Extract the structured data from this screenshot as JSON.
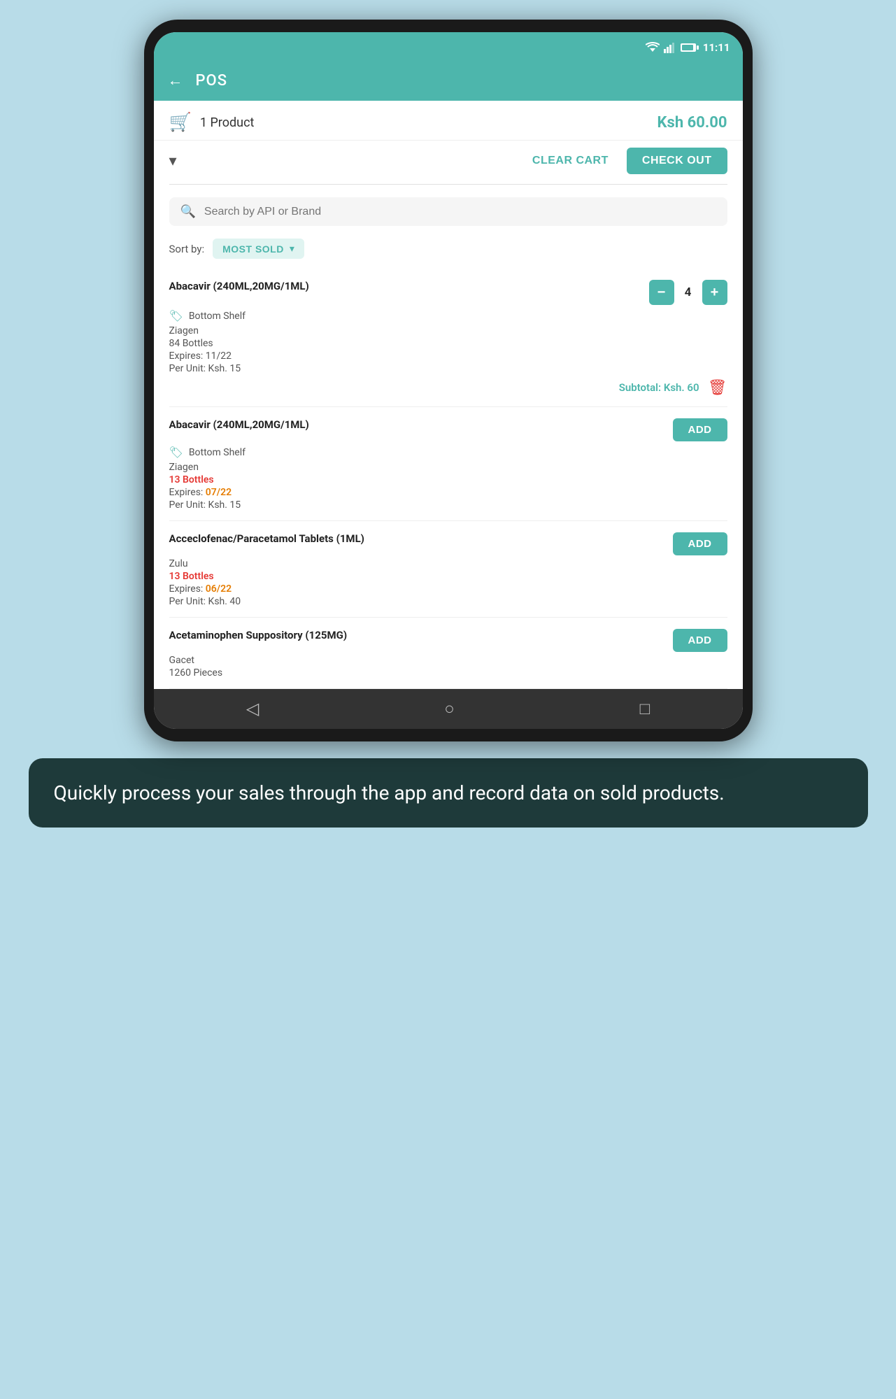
{
  "statusBar": {
    "time": "11:11"
  },
  "header": {
    "title": "POS",
    "backLabel": "←"
  },
  "cart": {
    "productCount": "1 Product",
    "total": "Ksh 60.00",
    "clearCartLabel": "CLEAR CART",
    "checkoutLabel": "CHECK OUT"
  },
  "search": {
    "placeholder": "Search by API or Brand"
  },
  "sort": {
    "label": "Sort by:",
    "value": "MOST SOLD"
  },
  "products": [
    {
      "id": 1,
      "name": "Abacavir (240ML,20MG/1ML)",
      "tag": "Bottom Shelf",
      "brand": "Ziagen",
      "stock": "84 Bottles",
      "stockLow": false,
      "expires": "Expires: ",
      "expiresDate": "11/22",
      "expiresWarn": false,
      "perUnit": "Per Unit: Ksh. 15",
      "hasQuantity": true,
      "quantity": 4,
      "subtotal": "Subtotal: Ksh. 60",
      "hasDelete": true
    },
    {
      "id": 2,
      "name": "Abacavir (240ML,20MG/1ML)",
      "tag": "Bottom Shelf",
      "brand": "Ziagen",
      "stock": "13 Bottles",
      "stockLow": true,
      "expires": "Expires: ",
      "expiresDate": "07/22",
      "expiresWarn": true,
      "perUnit": "Per Unit: Ksh. 15",
      "hasQuantity": false,
      "hasDelete": false
    },
    {
      "id": 3,
      "name": "Acceclofenac/Paracetamol Tablets (1ML)",
      "tag": null,
      "brand": "Zulu",
      "stock": "13 Bottles",
      "stockLow": true,
      "expires": "Expires: ",
      "expiresDate": "06/22",
      "expiresWarn": true,
      "perUnit": "Per Unit: Ksh. 40",
      "hasQuantity": false,
      "hasDelete": false
    },
    {
      "id": 4,
      "name": "Acetaminophen Suppository (125MG)",
      "tag": null,
      "brand": "Gacet",
      "stock": "1260 Pieces",
      "stockLow": false,
      "expires": null,
      "expiresDate": null,
      "expiresWarn": false,
      "perUnit": null,
      "hasQuantity": false,
      "hasDelete": false
    }
  ],
  "addButtonLabel": "ADD",
  "navBar": {
    "back": "◁",
    "home": "○",
    "recent": "□"
  },
  "caption": {
    "text": "Quickly process your sales through the app and record data on sold products."
  }
}
